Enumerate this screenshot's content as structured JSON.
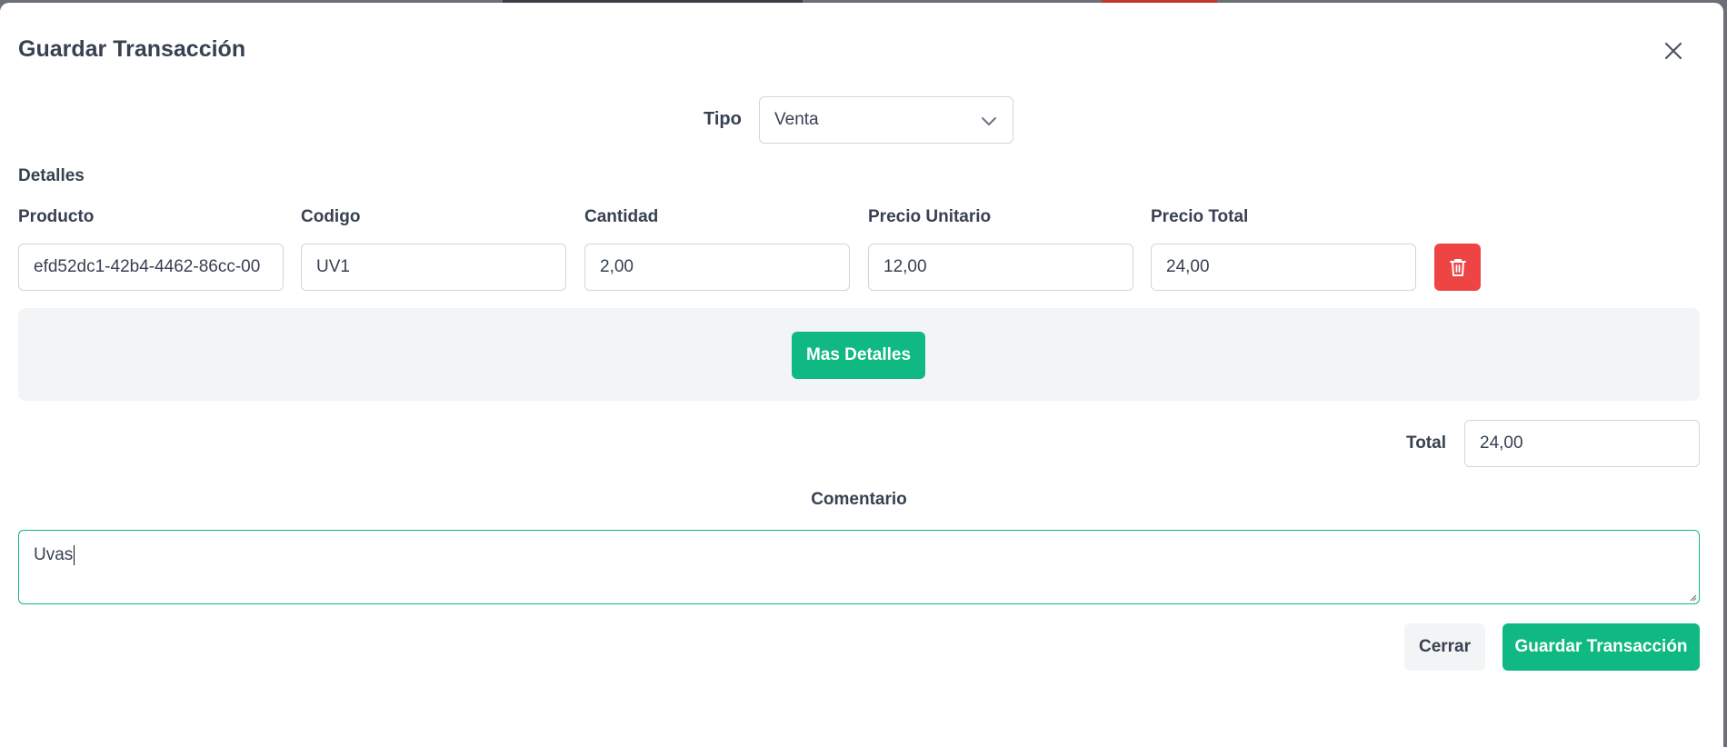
{
  "modal": {
    "title": "Guardar Transacción"
  },
  "tipo": {
    "label": "Tipo",
    "selected": "Venta"
  },
  "details": {
    "section_label": "Detalles",
    "columns": {
      "producto": "Producto",
      "codigo": "Codigo",
      "cantidad": "Cantidad",
      "precio_unitario": "Precio Unitario",
      "precio_total": "Precio Total"
    },
    "row": {
      "producto": "efd52dc1-42b4-4462-86cc-00",
      "codigo": "UV1",
      "cantidad": "2,00",
      "precio_unitario": "12,00",
      "precio_total": "24,00"
    },
    "more_button": "Mas Detalles"
  },
  "total": {
    "label": "Total",
    "value": "24,00"
  },
  "comment": {
    "label": "Comentario",
    "value": "Uvas"
  },
  "footer": {
    "cancel_label": "Cerrar",
    "save_label": "Guardar Transacción"
  },
  "colors": {
    "primary": "#10b981",
    "danger": "#ef4444",
    "panel": "#f3f4f6",
    "text": "#374151"
  },
  "icons": {
    "close": "close-icon",
    "select": "chevron-down-icon",
    "delete": "trash-icon",
    "resize": "resize-grip-icon"
  }
}
